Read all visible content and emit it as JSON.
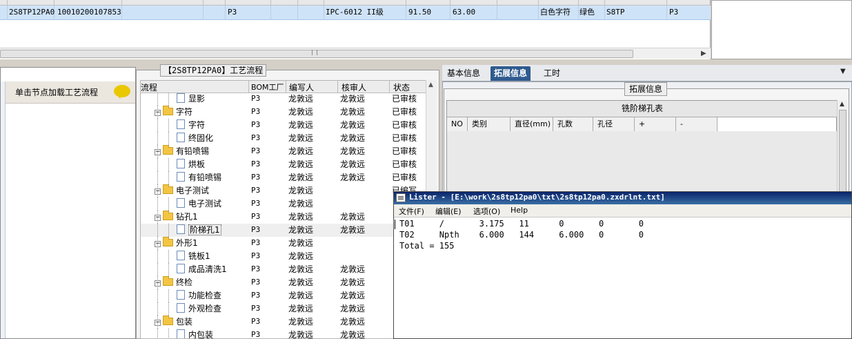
{
  "top_grid": {
    "row": [
      "2S8TP12PA0",
      "10010200107853",
      "P3",
      "IPC-6012 II级",
      "91.50",
      "63.00",
      "白色字符",
      "绿色",
      "S8TP",
      "P3"
    ]
  },
  "left_panel": {
    "hint": "单击节点加载工艺流程"
  },
  "process": {
    "title": "【2S8TP12PA0】工艺流程",
    "columns": [
      "流程",
      "BOM工厂",
      "编写人",
      "核审人",
      "状态"
    ],
    "rows": [
      {
        "name": "显影",
        "level": 2,
        "bom": "P3",
        "writer": "龙敦远",
        "reviewer": "龙敦远",
        "status": "已审核"
      },
      {
        "name": "字符",
        "level": 1,
        "bom": "P3",
        "writer": "龙敦远",
        "reviewer": "龙敦远",
        "status": "已审核"
      },
      {
        "name": "字符",
        "level": 2,
        "bom": "P3",
        "writer": "龙敦远",
        "reviewer": "龙敦远",
        "status": "已审核"
      },
      {
        "name": "终固化",
        "level": 2,
        "bom": "P3",
        "writer": "龙敦远",
        "reviewer": "龙敦远",
        "status": "已审核"
      },
      {
        "name": "有铅喷锡",
        "level": 1,
        "bom": "P3",
        "writer": "龙敦远",
        "reviewer": "龙敦远",
        "status": "已审核"
      },
      {
        "name": "烘板",
        "level": 2,
        "bom": "P3",
        "writer": "龙敦远",
        "reviewer": "龙敦远",
        "status": "已审核"
      },
      {
        "name": "有铅喷锡",
        "level": 2,
        "bom": "P3",
        "writer": "龙敦远",
        "reviewer": "龙敦远",
        "status": "已审核"
      },
      {
        "name": "电子测试",
        "level": 1,
        "bom": "P3",
        "writer": "龙敦远",
        "reviewer": "",
        "status": "已编写"
      },
      {
        "name": "电子测试",
        "level": 2,
        "bom": "P3",
        "writer": "龙敦远",
        "reviewer": "",
        "status": ""
      },
      {
        "name": "钻孔1",
        "level": 1,
        "bom": "P3",
        "writer": "龙敦远",
        "reviewer": "龙敦远",
        "status": ""
      },
      {
        "name": "阶梯孔1",
        "level": 2,
        "bom": "P3",
        "writer": "龙敦远",
        "reviewer": "龙敦远",
        "status": "",
        "selected": true
      },
      {
        "name": "外形1",
        "level": 1,
        "bom": "P3",
        "writer": "龙敦远",
        "reviewer": "",
        "status": ""
      },
      {
        "name": "铣板1",
        "level": 2,
        "bom": "P3",
        "writer": "龙敦远",
        "reviewer": "",
        "status": ""
      },
      {
        "name": "成品清洗1",
        "level": 2,
        "bom": "P3",
        "writer": "龙敦远",
        "reviewer": "龙敦远",
        "status": ""
      },
      {
        "name": "终检",
        "level": 1,
        "bom": "P3",
        "writer": "龙敦远",
        "reviewer": "龙敦远",
        "status": ""
      },
      {
        "name": "功能检查",
        "level": 2,
        "bom": "P3",
        "writer": "龙敦远",
        "reviewer": "龙敦远",
        "status": ""
      },
      {
        "name": "外观检查",
        "level": 2,
        "bom": "P3",
        "writer": "龙敦远",
        "reviewer": "龙敦远",
        "status": ""
      },
      {
        "name": "包装",
        "level": 1,
        "bom": "P3",
        "writer": "龙敦远",
        "reviewer": "龙敦远",
        "status": ""
      },
      {
        "name": "内包装",
        "level": 2,
        "bom": "P3",
        "writer": "龙敦远",
        "reviewer": "龙敦远",
        "status": ""
      }
    ]
  },
  "right_panel": {
    "tabs": [
      "基本信息",
      "拓展信息",
      "工时"
    ],
    "active_tab": 1,
    "group_title": "拓展信息",
    "table_title": "铣阶梯孔表",
    "table_columns": [
      "NO",
      "类别",
      "直径(mm)",
      "孔数",
      "孔径",
      "+",
      "-"
    ]
  },
  "lister": {
    "title": "Lister - [E:\\work\\2s8tp12pa0\\txt\\2s8tp12pa0.zxdrlnt.txt]",
    "menu": [
      "文件(F)",
      "编辑(E)",
      "选项(O)",
      "Help"
    ],
    "lines": [
      "T01     /       3.175   11      0       0       0",
      "T02     Npth    6.000   144     6.000   0       0",
      "Total = 155"
    ]
  },
  "colors": {
    "selection": "#cfe3f8",
    "tab_active": "#2e5a8e",
    "titlebar": "#0a246a"
  }
}
